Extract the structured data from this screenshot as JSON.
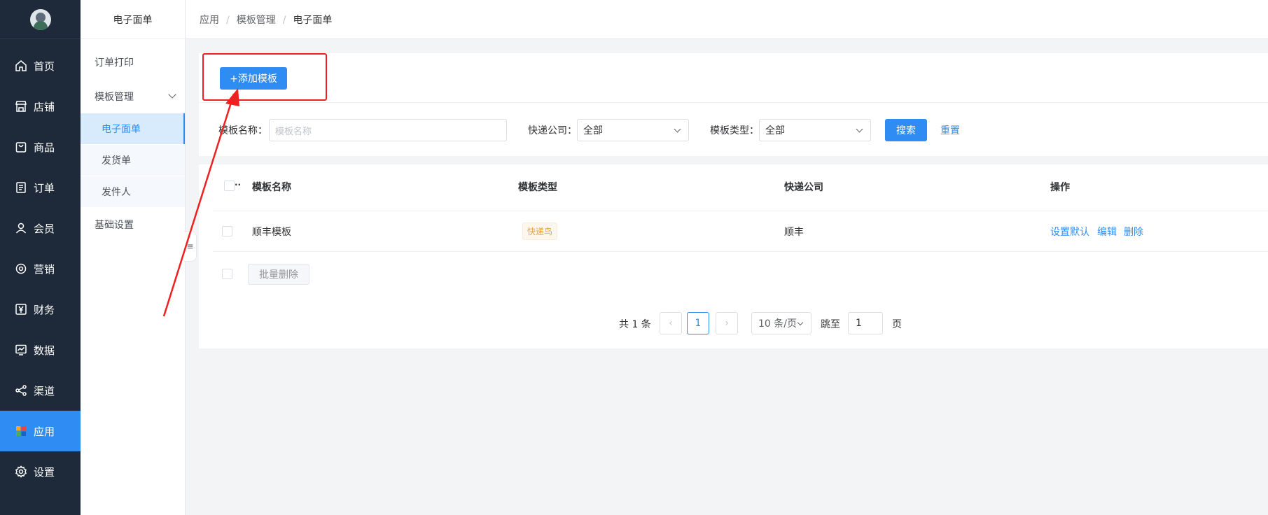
{
  "nav": {
    "items": [
      {
        "label": "首页",
        "icon": "home-icon"
      },
      {
        "label": "店铺",
        "icon": "store-icon"
      },
      {
        "label": "商品",
        "icon": "bag-icon"
      },
      {
        "label": "订单",
        "icon": "order-icon"
      },
      {
        "label": "会员",
        "icon": "user-icon"
      },
      {
        "label": "营销",
        "icon": "marketing-icon"
      },
      {
        "label": "财务",
        "icon": "yen-icon"
      },
      {
        "label": "数据",
        "icon": "chart-icon"
      },
      {
        "label": "渠道",
        "icon": "share-icon"
      },
      {
        "label": "应用",
        "icon": "apps-icon",
        "active": true
      },
      {
        "label": "设置",
        "icon": "settings-icon"
      }
    ]
  },
  "submenu": {
    "title": "电子面单",
    "items": [
      {
        "label": "订单打印"
      },
      {
        "label": "模板管理"
      },
      {
        "label": "电子面单"
      },
      {
        "label": "发货单"
      },
      {
        "label": "发件人"
      },
      {
        "label": "基础设置"
      }
    ]
  },
  "breadcrumb": [
    "应用",
    "模板管理",
    "电子面单"
  ],
  "toolbar": {
    "add_label": "+添加模板"
  },
  "filters": {
    "name_label": "模板名称：",
    "name_placeholder": "模板名称",
    "company_label": "快递公司：",
    "company_value": "全部",
    "type_label": "模板类型：",
    "type_value": "全部",
    "search_label": "搜索",
    "reset_label": "重置"
  },
  "table": {
    "columns": [
      "模板名称",
      "模板类型",
      "快递公司",
      "操作"
    ],
    "rows": [
      {
        "name": "顺丰模板",
        "type": "快递鸟",
        "company": "顺丰",
        "ops": [
          "设置默认",
          "编辑",
          "删除"
        ]
      }
    ],
    "batch_delete_label": "批量删除"
  },
  "pagination": {
    "total_text": "共 1 条",
    "current_page": "1",
    "page_size": "10 条/页",
    "jump_label": "跳至",
    "jump_value": "1",
    "page_unit": "页",
    "prev_glyph": "‹",
    "next_glyph": "›"
  },
  "colors": {
    "primary": "#2f8cf2",
    "sidebar": "#1e2a3a",
    "annotation": "#f02020",
    "tag": "#e6a23c"
  }
}
